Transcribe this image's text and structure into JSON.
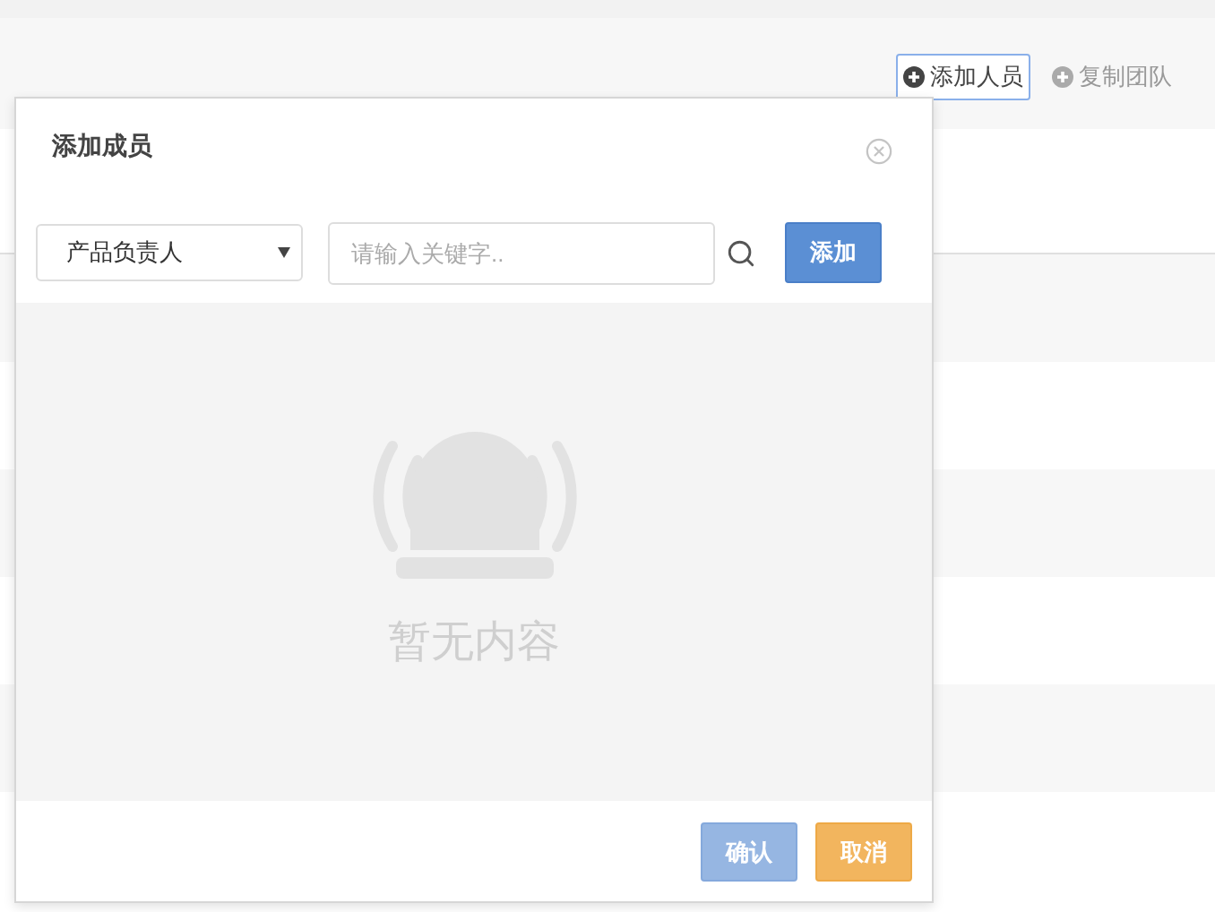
{
  "toolbar": {
    "buttons": [
      {
        "label": "添加人员",
        "selected": true
      },
      {
        "label": "复制团队",
        "selected": false
      }
    ]
  },
  "dialog": {
    "title": "添加成员",
    "role_select": {
      "value": "产品负责人"
    },
    "search": {
      "placeholder": "请输入关键字.."
    },
    "add_button": "添加",
    "empty_text": "暂无内容",
    "footer_buttons": [
      {
        "label": "确认",
        "kind": "confirm",
        "disabled": true
      },
      {
        "label": "取消",
        "kind": "cancel",
        "disabled": false
      }
    ]
  }
}
